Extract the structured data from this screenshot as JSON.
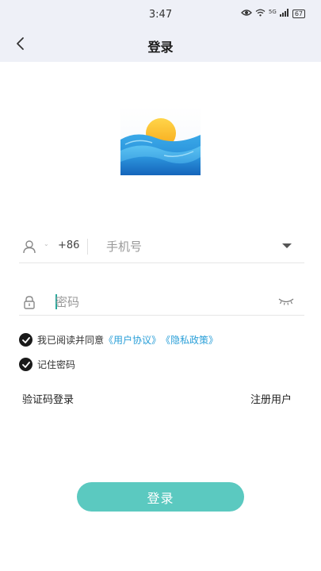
{
  "status_bar": {
    "time": "3:47",
    "network": "5G",
    "battery": "67"
  },
  "nav": {
    "title": "登录",
    "back_icon": "chevron-left-icon"
  },
  "logo": {
    "icon": "sunrise-waves-logo"
  },
  "phone": {
    "country_code": "+86",
    "placeholder": "手机号",
    "user_icon": "user-icon",
    "dropdown_icon": "caret-down-icon"
  },
  "password": {
    "placeholder": "密码",
    "lock_icon": "lock-icon",
    "visibility_icon": "eye-closed-icon"
  },
  "agreement": {
    "prefix": "我已阅读并同意",
    "user_agreement": "《用户协议》",
    "privacy_policy": "《隐私政策》"
  },
  "remember": {
    "label": "记住密码"
  },
  "links": {
    "sms_login": "验证码登录",
    "register": "注册用户"
  },
  "login_button": {
    "label": "登录"
  },
  "colors": {
    "accent": "#5bc9c0",
    "link": "#2a9fd8",
    "header_bg": "#eef0f7"
  }
}
